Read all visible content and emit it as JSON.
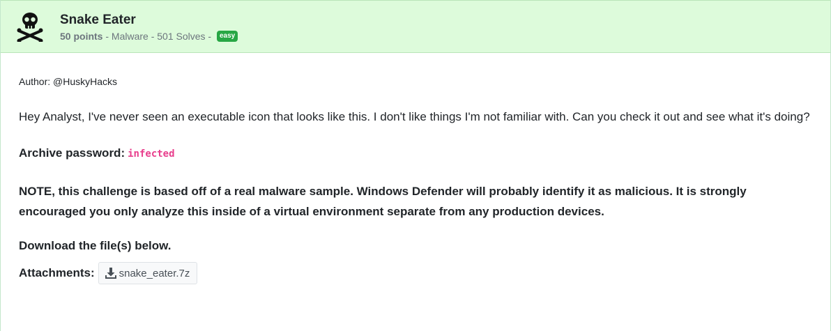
{
  "challenge": {
    "title": "Snake Eater",
    "points": "50 points",
    "meta_rest": " - Malware - 501 Solves - ",
    "difficulty": "easy",
    "icon": "skull-crossbones-icon"
  },
  "content": {
    "author": "Author: @HuskyHacks",
    "description": "Hey Analyst, I've never seen an executable icon that looks like this. I don't like things I'm not familiar with. Can you check it out and see what it's doing?",
    "password_label": "Archive password:",
    "password_value": "infected",
    "note": "NOTE, this challenge is based off of a real malware sample. Windows Defender will probably identify it as malicious. It is strongly encouraged you only analyze this inside of a virtual environment separate from any production devices.",
    "download_text": "Download the file(s) below.",
    "attachments_label": "Attachments:",
    "attachments": [
      {
        "name": "snake_eater.7z",
        "icon": "download-icon"
      }
    ]
  },
  "colors": {
    "header_bg": "#ddfbdb",
    "badge": "#28a745",
    "code": "#e83e8c"
  }
}
